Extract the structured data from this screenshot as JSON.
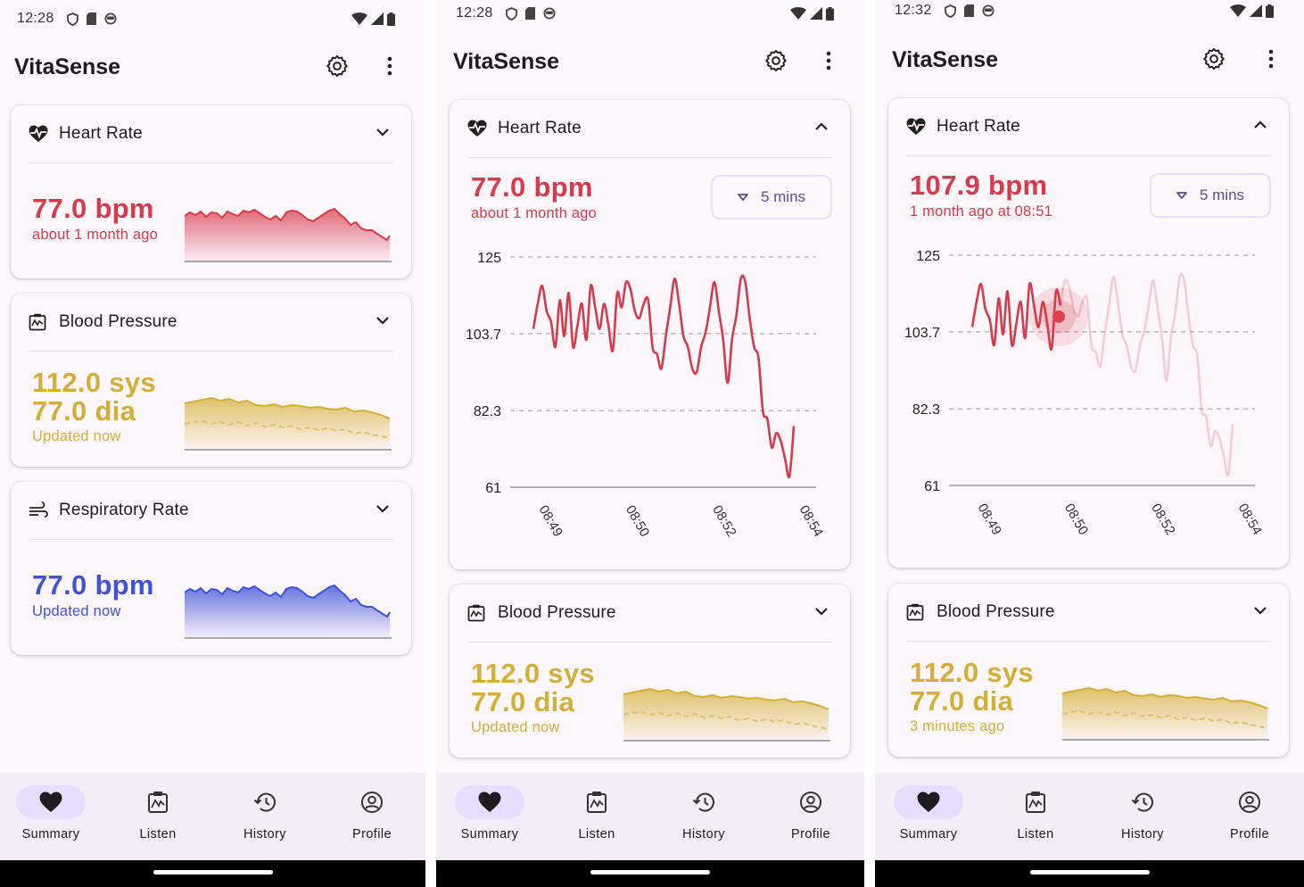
{
  "status_bar": {
    "screen1_time": "12:28",
    "screen2_time": "12:28",
    "screen3_time": "12:32"
  },
  "app": {
    "title": "VitaSense"
  },
  "icons": {
    "settings": "gear-icon",
    "more": "more-vert-icon",
    "heart": "heart-monitor-icon",
    "blood_pressure": "monitor-chart-icon",
    "respiratory": "wind-icon",
    "expand": "chevron-down-icon",
    "collapse": "chevron-up-icon",
    "dropdown": "triangle-down-icon"
  },
  "colors": {
    "heart": "#d73a4a",
    "blood_pressure": "#d4af37",
    "respiratory": "#3f53d6",
    "accent": "#e9ddff"
  },
  "screen1": {
    "heart_rate": {
      "title": "Heart Rate",
      "value": "77.0 bpm",
      "subtitle": "about 1 month ago"
    },
    "blood_pressure": {
      "title": "Blood Pressure",
      "systolic": "112.0 sys",
      "diastolic": "77.0 dia",
      "subtitle": "Updated now"
    },
    "respiratory_rate": {
      "title": "Respiratory Rate",
      "value": "77.0 bpm",
      "subtitle": "Updated now"
    }
  },
  "screen2": {
    "heart_rate": {
      "title": "Heart Rate",
      "value": "77.0 bpm",
      "subtitle": "about 1 month ago",
      "range": "5 mins"
    },
    "blood_pressure": {
      "title": "Blood Pressure",
      "systolic": "112.0 sys",
      "diastolic": "77.0 dia",
      "subtitle": "Updated now"
    }
  },
  "screen3": {
    "heart_rate": {
      "title": "Heart Rate",
      "value": "107.9 bpm",
      "subtitle": "1 month ago at 08:51",
      "range": "5 mins"
    },
    "blood_pressure": {
      "title": "Blood Pressure",
      "systolic": "112.0 sys",
      "diastolic": "77.0 dia",
      "subtitle": "3 minutes ago"
    }
  },
  "bottom_nav": [
    {
      "label": "Summary",
      "icon": "heart-icon",
      "active": true
    },
    {
      "label": "Listen",
      "icon": "monitor-chart-icon",
      "active": false
    },
    {
      "label": "History",
      "icon": "history-icon",
      "active": false
    },
    {
      "label": "Profile",
      "icon": "account-circle-icon",
      "active": false
    }
  ],
  "chart_data": [
    {
      "type": "line",
      "title": "",
      "ylabel": "",
      "ylim": [
        61,
        125
      ],
      "yticks": [
        "125",
        "103.7",
        "82.3",
        "61"
      ],
      "xticks": [
        "08:49",
        "08:50",
        "08:52",
        "08:54"
      ],
      "grid": "horizontal dashed",
      "series": [
        {
          "values": [
            105,
            112,
            117,
            110,
            107,
            100,
            113,
            103,
            115,
            100,
            106,
            112,
            102,
            117,
            111,
            105,
            112,
            106,
            99,
            115,
            111,
            118,
            116,
            110,
            108,
            112,
            113,
            100,
            98,
            94,
            103,
            111,
            119,
            112,
            103,
            100,
            94,
            93,
            100,
            104,
            111,
            118,
            110,
            102,
            90,
            102,
            109,
            119,
            118,
            108,
            100,
            97,
            82,
            80,
            72,
            76,
            74,
            69,
            64,
            78
          ]
        }
      ]
    },
    {
      "type": "line",
      "title": "",
      "ylabel": "",
      "ylim": [
        61,
        125
      ],
      "yticks": [
        "125",
        "103.7",
        "82.3",
        "61"
      ],
      "xticks": [
        "08:49",
        "08:50",
        "08:52",
        "08:54"
      ],
      "grid": "horizontal dashed",
      "selected_point": {
        "x": "08:51",
        "y": 107.9
      },
      "series": [
        {
          "values": [
            105,
            112,
            117,
            110,
            107,
            100,
            113,
            103,
            115,
            100,
            106,
            112,
            102,
            117,
            111,
            105,
            112,
            106,
            99,
            115,
            111,
            118,
            116,
            110,
            108,
            112,
            113,
            100,
            98,
            94,
            103,
            111,
            119,
            112,
            103,
            100,
            94,
            93,
            100,
            104,
            111,
            118,
            110,
            102,
            90,
            102,
            109,
            119,
            118,
            108,
            100,
            97,
            82,
            80,
            72,
            76,
            74,
            69,
            64,
            78
          ]
        }
      ]
    }
  ]
}
